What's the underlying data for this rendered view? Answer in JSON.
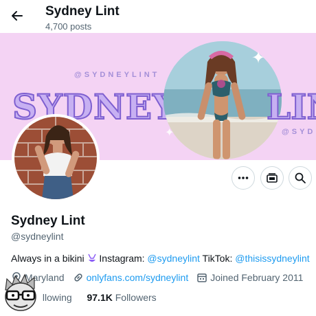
{
  "header": {
    "title": "Sydney Lint",
    "post_count": "4,700 posts"
  },
  "banner": {
    "handle_text": "@SYDNEYLINT",
    "handle_text_right": "@SYD",
    "name_text": "SYDNEY",
    "name_text_right": "LINT",
    "background_color": "#f4d3f4",
    "accent_color": "#8e6fd8"
  },
  "profile": {
    "display_name": "Sydney Lint",
    "handle": "@sydneylint",
    "bio_prefix": "Always in a bikini",
    "bio_instagram_label": "Instagram:",
    "bio_instagram_handle": "@sydneylint",
    "bio_tiktok_label": "TikTok:",
    "bio_tiktok_handle": "@thisissydneylint",
    "location": "Maryland",
    "website": "onlyfans.com/sydneylint",
    "joined": "Joined February 2011",
    "following_label": "llowing",
    "followers_count": "97.1K",
    "followers_label": "Followers"
  },
  "actions": {
    "more_icon": "more-icon",
    "subscriptions_icon": "subscriptions-icon",
    "search_icon": "search-icon"
  },
  "colors": {
    "link": "#1d9bf0",
    "muted": "#536471",
    "text": "#0f1419"
  }
}
